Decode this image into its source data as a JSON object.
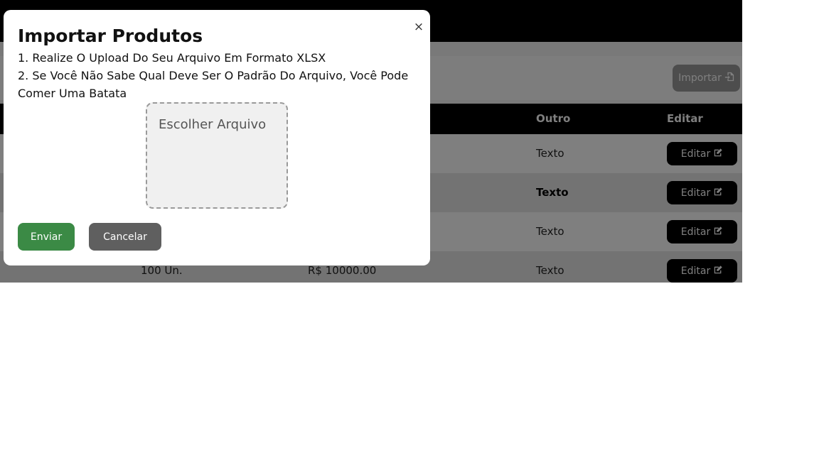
{
  "background": {
    "toolbar": {
      "import_label": "Importar",
      "import_icon": "file-import-icon"
    },
    "table": {
      "headers": {
        "outro": "Outro",
        "editar": "Editar"
      },
      "rows": [
        {
          "quantity": "",
          "price": "",
          "outro": "Texto",
          "edit_label": "Editar",
          "bold": false
        },
        {
          "quantity": "",
          "price": "",
          "outro": "Texto",
          "edit_label": "Editar",
          "bold": true
        },
        {
          "quantity": "",
          "price": "",
          "outro": "Texto",
          "edit_label": "Editar",
          "bold": false
        },
        {
          "quantity": "100 Un.",
          "price": "R$ 10000.00",
          "outro": "Texto",
          "edit_label": "Editar",
          "bold": false
        }
      ]
    }
  },
  "modal": {
    "title": "Importar Produtos",
    "close_label": "×",
    "instructions": {
      "line1": "1. Realize O Upload Do Seu Arquivo Em Formato XLSX",
      "line2": "2. Se Você Não Sabe Qual Deve Ser O Padrão Do Arquivo, Você Pode Comer Uma Batata"
    },
    "file_input_label": "Escolher Arquivo",
    "send_label": "Enviar",
    "cancel_label": "Cancelar"
  },
  "colors": {
    "send": "#3b8a45",
    "cancel": "#5f5f5f",
    "header": "#000000"
  }
}
